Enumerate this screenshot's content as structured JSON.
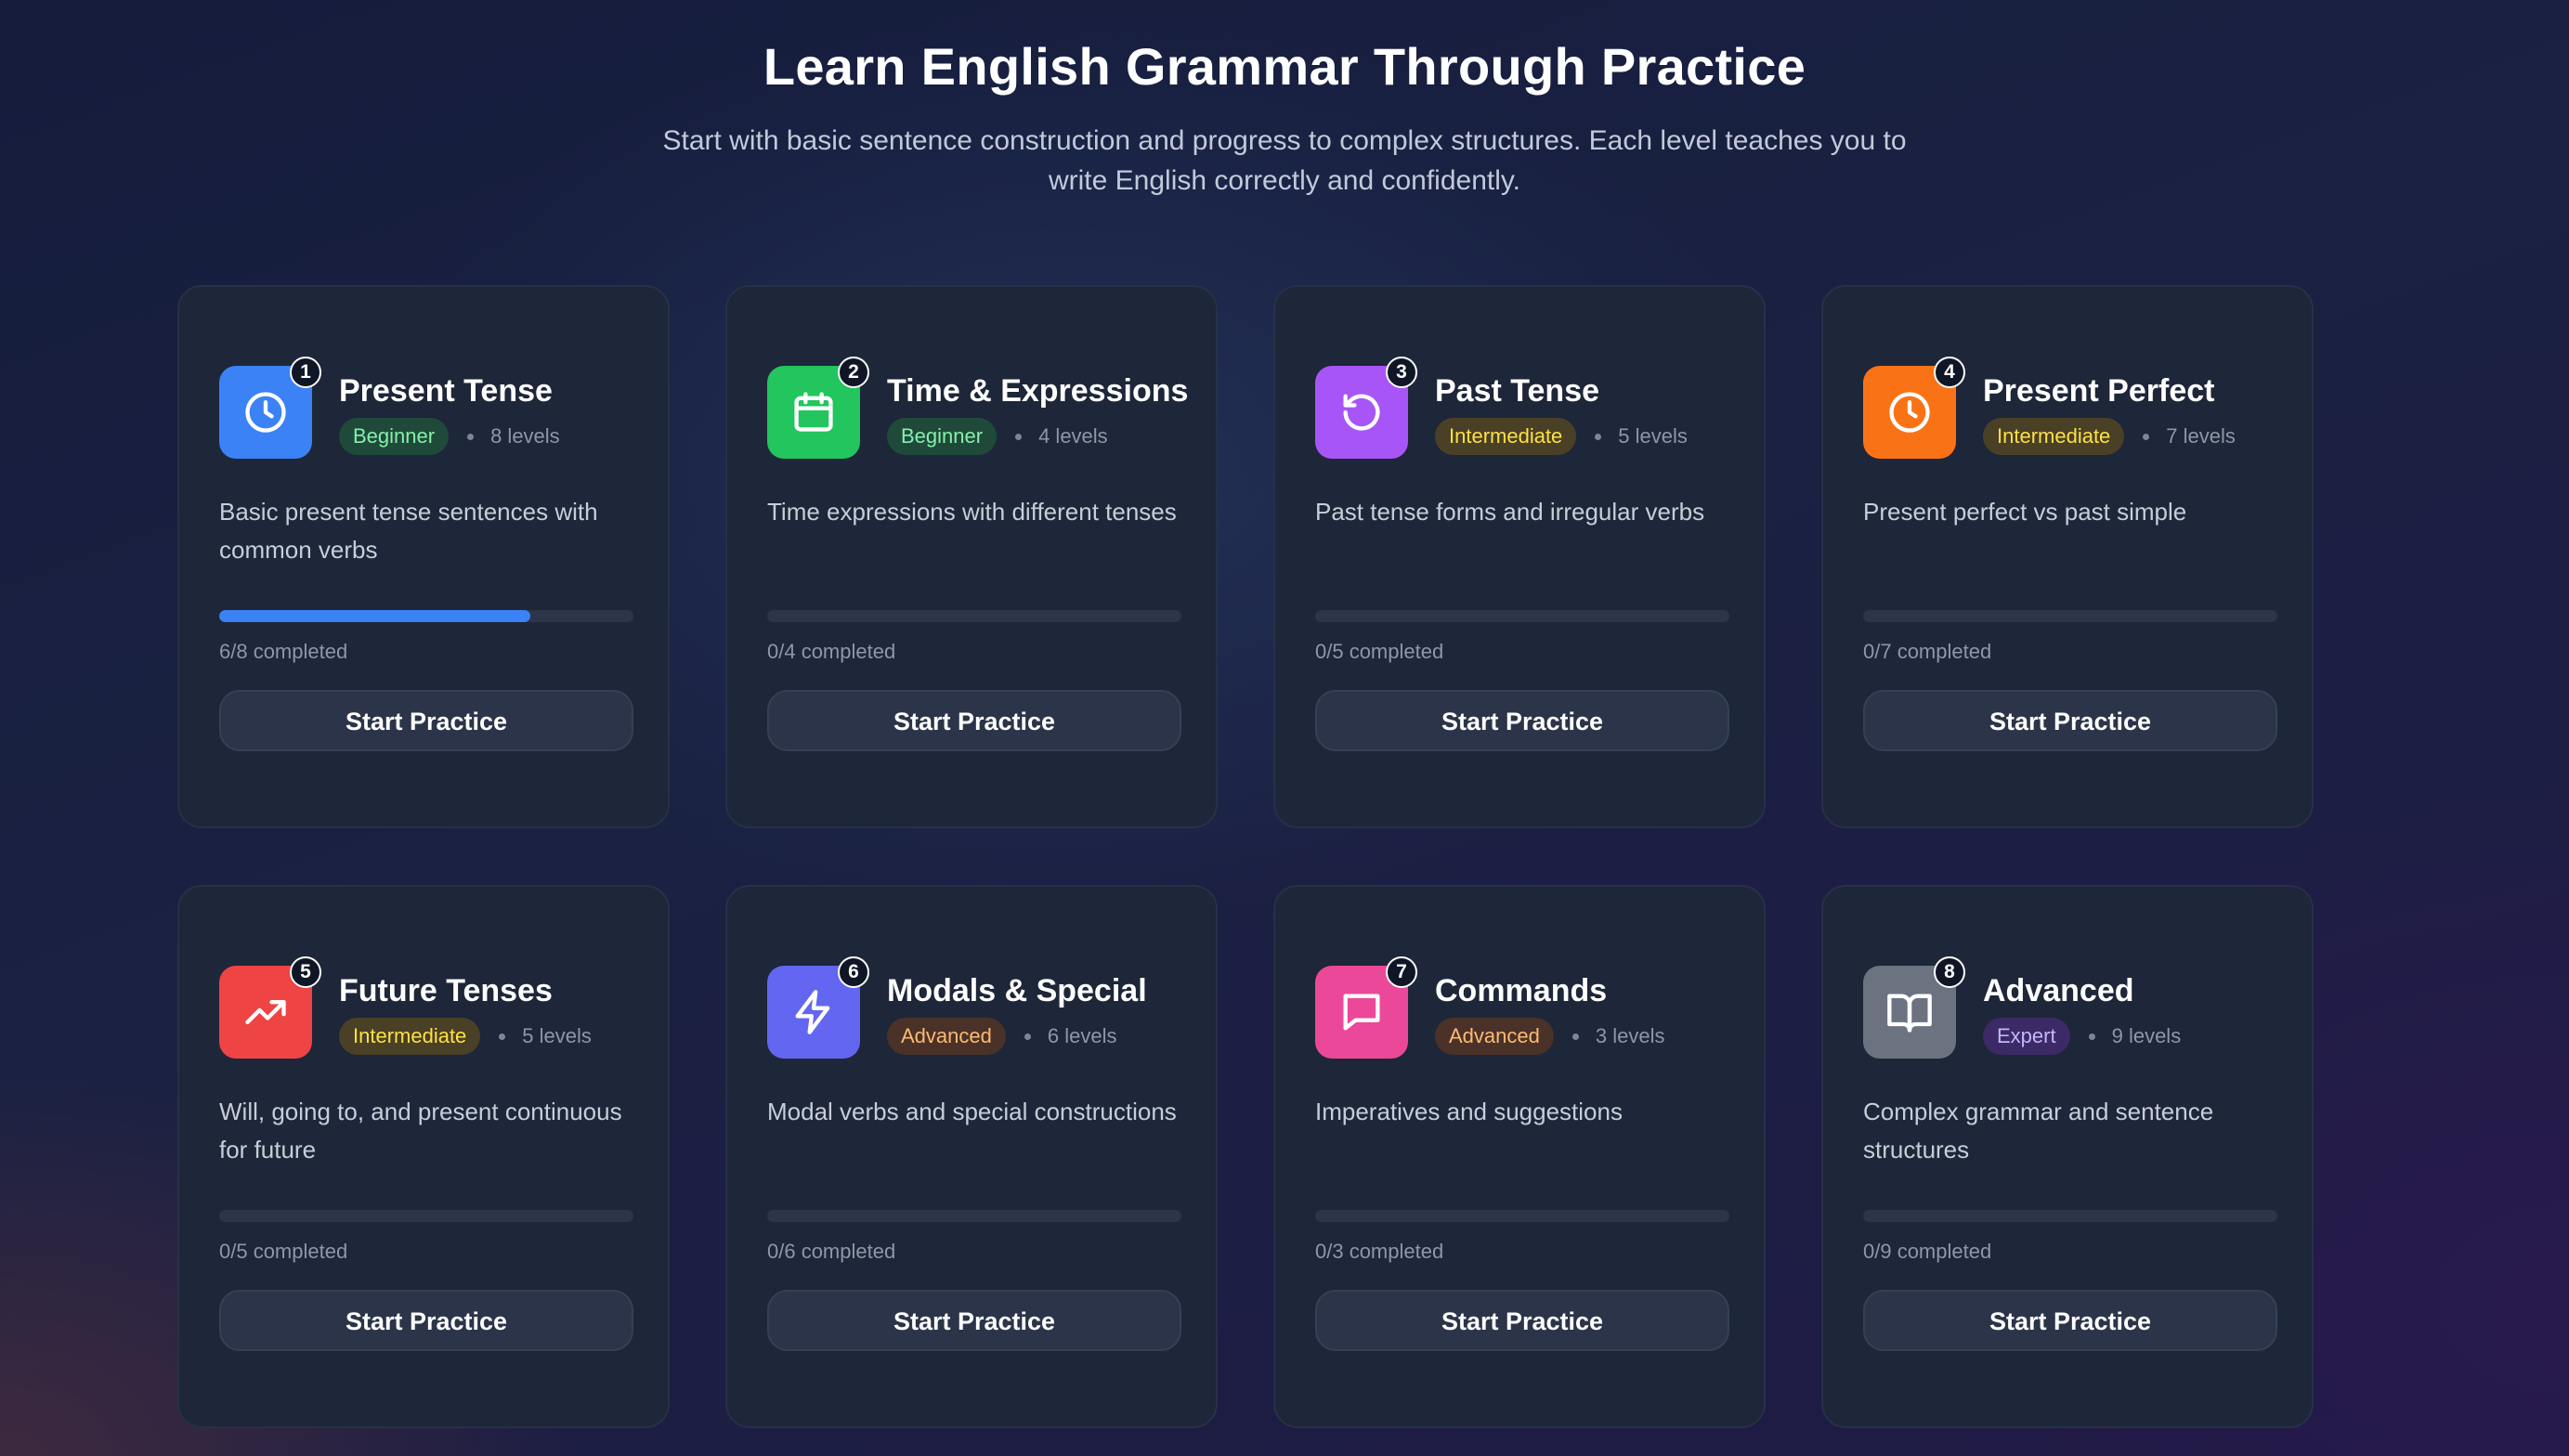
{
  "header": {
    "title": "Learn English Grammar Through Practice",
    "subtitle": "Start with basic sentence construction and progress to complex structures. Each level teaches you to write English correctly and confidently."
  },
  "colors": {
    "beginner_bg": "#1f4a3a",
    "beginner_text": "#86efac",
    "intermediate_bg": "#4a4025",
    "intermediate_text": "#fde047",
    "advanced_bg": "#4a3228",
    "advanced_text": "#fdba74",
    "expert_bg": "#3b2a66",
    "expert_text": "#c4b5fd",
    "progress_fill": "#3b82f6"
  },
  "cards": [
    {
      "number": "1",
      "title": "Present Tense",
      "level": "Beginner",
      "levels_count": "8 levels",
      "description": "Basic present tense sentences with common verbs",
      "progress_text": "6/8 completed",
      "progress": 0.75,
      "button_label": "Start Practice",
      "icon": "clock-icon",
      "icon_color": "#3b82f6"
    },
    {
      "number": "2",
      "title": "Time & Expressions",
      "level": "Beginner",
      "levels_count": "4 levels",
      "description": "Time expressions with different tenses",
      "progress_text": "0/4 completed",
      "progress": 0,
      "button_label": "Start Practice",
      "icon": "calendar-icon",
      "icon_color": "#22c55e"
    },
    {
      "number": "3",
      "title": "Past Tense",
      "level": "Intermediate",
      "levels_count": "5 levels",
      "description": "Past tense forms and irregular verbs",
      "progress_text": "0/5 completed",
      "progress": 0,
      "button_label": "Start Practice",
      "icon": "rotate-ccw-icon",
      "icon_color": "#a855f7"
    },
    {
      "number": "4",
      "title": "Present Perfect",
      "level": "Intermediate",
      "levels_count": "7 levels",
      "description": "Present perfect vs past simple",
      "progress_text": "0/7 completed",
      "progress": 0,
      "button_label": "Start Practice",
      "icon": "clock-icon",
      "icon_color": "#f97316"
    },
    {
      "number": "5",
      "title": "Future Tenses",
      "level": "Intermediate",
      "levels_count": "5 levels",
      "description": "Will, going to, and present continuous for future",
      "progress_text": "0/5 completed",
      "progress": 0,
      "button_label": "Start Practice",
      "icon": "trending-up-icon",
      "icon_color": "#ef4444"
    },
    {
      "number": "6",
      "title": "Modals & Special",
      "level": "Advanced",
      "levels_count": "6 levels",
      "description": "Modal verbs and special constructions",
      "progress_text": "0/6 completed",
      "progress": 0,
      "button_label": "Start Practice",
      "icon": "zap-icon",
      "icon_color": "#6366f1"
    },
    {
      "number": "7",
      "title": "Commands",
      "level": "Advanced",
      "levels_count": "3 levels",
      "description": "Imperatives and suggestions",
      "progress_text": "0/3 completed",
      "progress": 0,
      "button_label": "Start Practice",
      "icon": "message-square-icon",
      "icon_color": "#ec4899"
    },
    {
      "number": "8",
      "title": "Advanced",
      "level": "Expert",
      "levels_count": "9 levels",
      "description": "Complex grammar and sentence structures",
      "progress_text": "0/9 completed",
      "progress": 0,
      "button_label": "Start Practice",
      "icon": "book-open-icon",
      "icon_color": "#6b7280"
    }
  ]
}
